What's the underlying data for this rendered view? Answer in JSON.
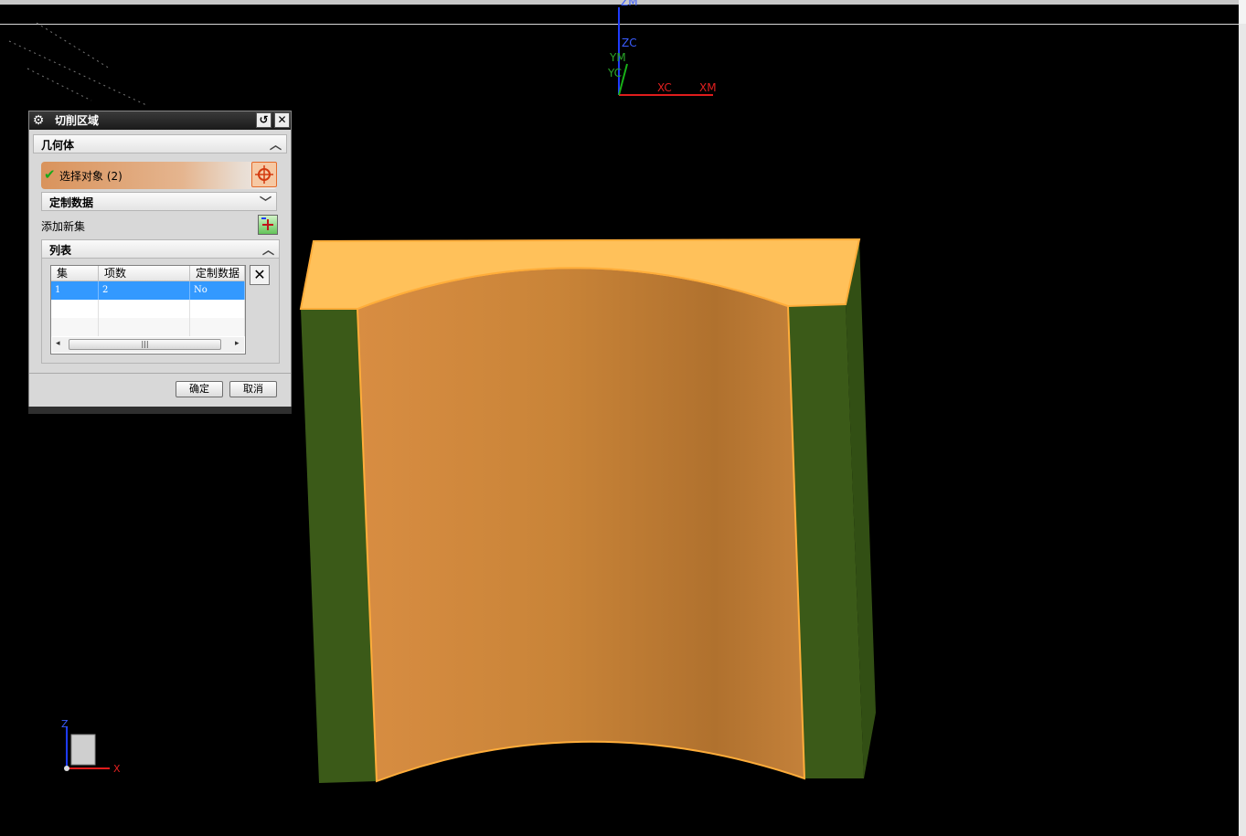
{
  "viewport": {
    "triad_labels": [
      "ZM",
      "ZC",
      "YM",
      "YC",
      "XC",
      "XM"
    ],
    "mini_triad_labels": [
      "Z",
      "X"
    ],
    "colors": {
      "part_top": "#ffc15a",
      "part_inner": "#c98438",
      "part_side": "#3b5a18",
      "edge_highlight": "#ffad3a"
    }
  },
  "dialog": {
    "title": "切削区域",
    "reset_icon": "reset-icon",
    "close_icon": "close-icon",
    "geometry_section": {
      "label": "几何体"
    },
    "select_objects": {
      "label": "选择对象  (2)",
      "status": "selected"
    },
    "custom_data_section": {
      "label": "定制数据"
    },
    "add_new_set": {
      "label": "添加新集"
    },
    "list_section": {
      "label": "列表",
      "columns": [
        "集",
        "项数",
        "定制数据"
      ],
      "rows": [
        {
          "set": "1",
          "count": "2",
          "custom": "No",
          "selected": true
        }
      ]
    },
    "buttons": {
      "ok": "确定",
      "cancel": "取消"
    }
  }
}
